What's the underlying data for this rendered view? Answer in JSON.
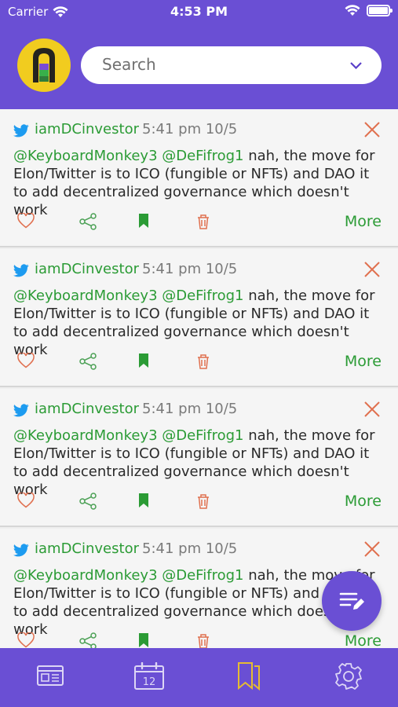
{
  "status_bar": {
    "carrier": "Carrier",
    "time": "4:53 PM"
  },
  "search": {
    "placeholder": "Search"
  },
  "feed": {
    "posts": [
      {
        "author": "iamDCinvestor",
        "time": "5:41 pm 10/5",
        "mentions": "@KeyboardMonkey3 @DeFifrog1",
        "text": "nah, the move for Elon/Twitter is to ICO (fungible or NFTs) and DAO it to add decentralized governance which doesn't work",
        "more_label": "More"
      },
      {
        "author": "iamDCinvestor",
        "time": "5:41 pm 10/5",
        "mentions": "@KeyboardMonkey3 @DeFifrog1",
        "text": "nah, the move for Elon/Twitter is to ICO (fungible or NFTs) and DAO it to add decentralized governance which doesn't work",
        "more_label": "More"
      },
      {
        "author": "iamDCinvestor",
        "time": "5:41 pm 10/5",
        "mentions": "@KeyboardMonkey3 @DeFifrog1",
        "text": "nah, the move for Elon/Twitter is to ICO (fungible or NFTs) and DAO it to add decentralized governance which doesn't work",
        "more_label": "More"
      },
      {
        "author": "iamDCinvestor",
        "time": "5:41 pm 10/5",
        "mentions": "@KeyboardMonkey3 @DeFifrog1",
        "text": "nah, the move for Elon/Twitter is to ICO (fungible or NFTs) and DAO it to add decentralized governance which doesn't work",
        "more_label": "More"
      }
    ]
  },
  "tab_bar": {
    "tabs": [
      {
        "icon": "news-icon",
        "label": ""
      },
      {
        "icon": "calendar-icon",
        "label": "",
        "badge": "12"
      },
      {
        "icon": "bookmarks-icon",
        "label": ""
      },
      {
        "icon": "gear-icon",
        "label": ""
      }
    ]
  },
  "colors": {
    "header": "#6a4fd4",
    "accent_green": "#2b9b35",
    "action_red": "#e0704f",
    "active_tab": "#e6bc32"
  }
}
